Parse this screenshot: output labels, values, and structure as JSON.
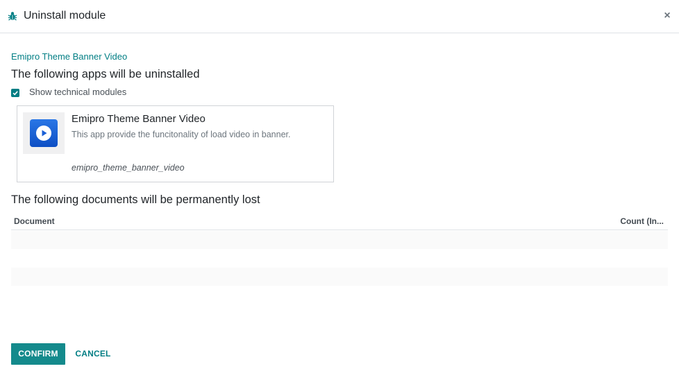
{
  "dialog": {
    "title": "Uninstall module",
    "close_label": "×",
    "icon": "bug-icon"
  },
  "module": {
    "name": "Emipro Theme Banner Video"
  },
  "apps_section": {
    "heading": "The following apps will be uninstalled",
    "show_technical_label": "Show technical modules",
    "show_technical_checked": true
  },
  "app_card": {
    "name": "Emipro Theme Banner Video",
    "description": "This app provide the funcitonality of load video in banner.",
    "technical_name": "emipro_theme_banner_video",
    "icon": "play-icon"
  },
  "documents_section": {
    "heading": "The following documents will be permanently lost",
    "columns": [
      "Document",
      "Count (In..."
    ],
    "rows": []
  },
  "footer": {
    "confirm_label": "CONFIRM",
    "cancel_label": "CANCEL"
  },
  "colors": {
    "accent": "#017e84",
    "confirm_bg": "#148a8c"
  }
}
